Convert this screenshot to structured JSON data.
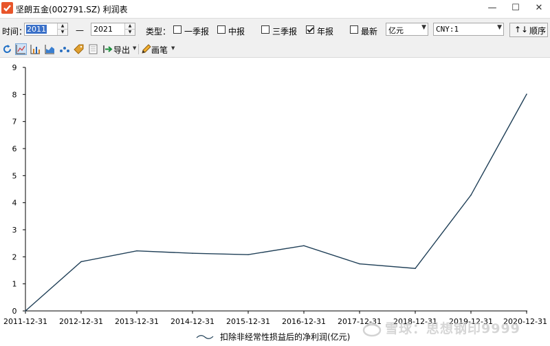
{
  "window": {
    "title": "坚朗五金(002791.SZ) 利润表",
    "minimize": "—",
    "maximize": "☐",
    "close": "✕"
  },
  "filters": {
    "time_label": "时间：",
    "start_year": "2011",
    "range_dash": "—",
    "end_year": "2021",
    "type_label": "类型：",
    "periods": [
      {
        "label": "一季报",
        "checked": false
      },
      {
        "label": "中报",
        "checked": false
      },
      {
        "label": "三季报",
        "checked": false
      },
      {
        "label": "年报",
        "checked": true
      },
      {
        "label": "最新",
        "checked": false
      }
    ],
    "unit": "亿元",
    "currency": "CNY:1",
    "sort_arrows": "↑↓",
    "sort_label": "顺序"
  },
  "toolbar2": {
    "export_label": "导出",
    "pen_label": "画笔"
  },
  "chart_data": {
    "type": "line",
    "x": [
      "2011-12-31",
      "2012-12-31",
      "2013-12-31",
      "2014-12-31",
      "2015-12-31",
      "2016-12-31",
      "2017-12-31",
      "2018-12-31",
      "2019-12-31",
      "2020-12-31"
    ],
    "series": [
      {
        "name": "扣除非经常性损益后的净利润(亿元)",
        "values": [
          0.0,
          1.82,
          2.22,
          2.13,
          2.08,
          2.41,
          1.74,
          1.57,
          4.28,
          8.01
        ],
        "color": "#1f3f57"
      }
    ],
    "y_ticks": [
      "0",
      "1",
      "2",
      "3",
      "4",
      "5",
      "6",
      "7",
      "8",
      "9"
    ],
    "ylim": [
      0,
      9
    ],
    "grid": false,
    "legend_position": "bottom-center"
  },
  "watermark": {
    "text": "雪球：思想钢印9999"
  }
}
